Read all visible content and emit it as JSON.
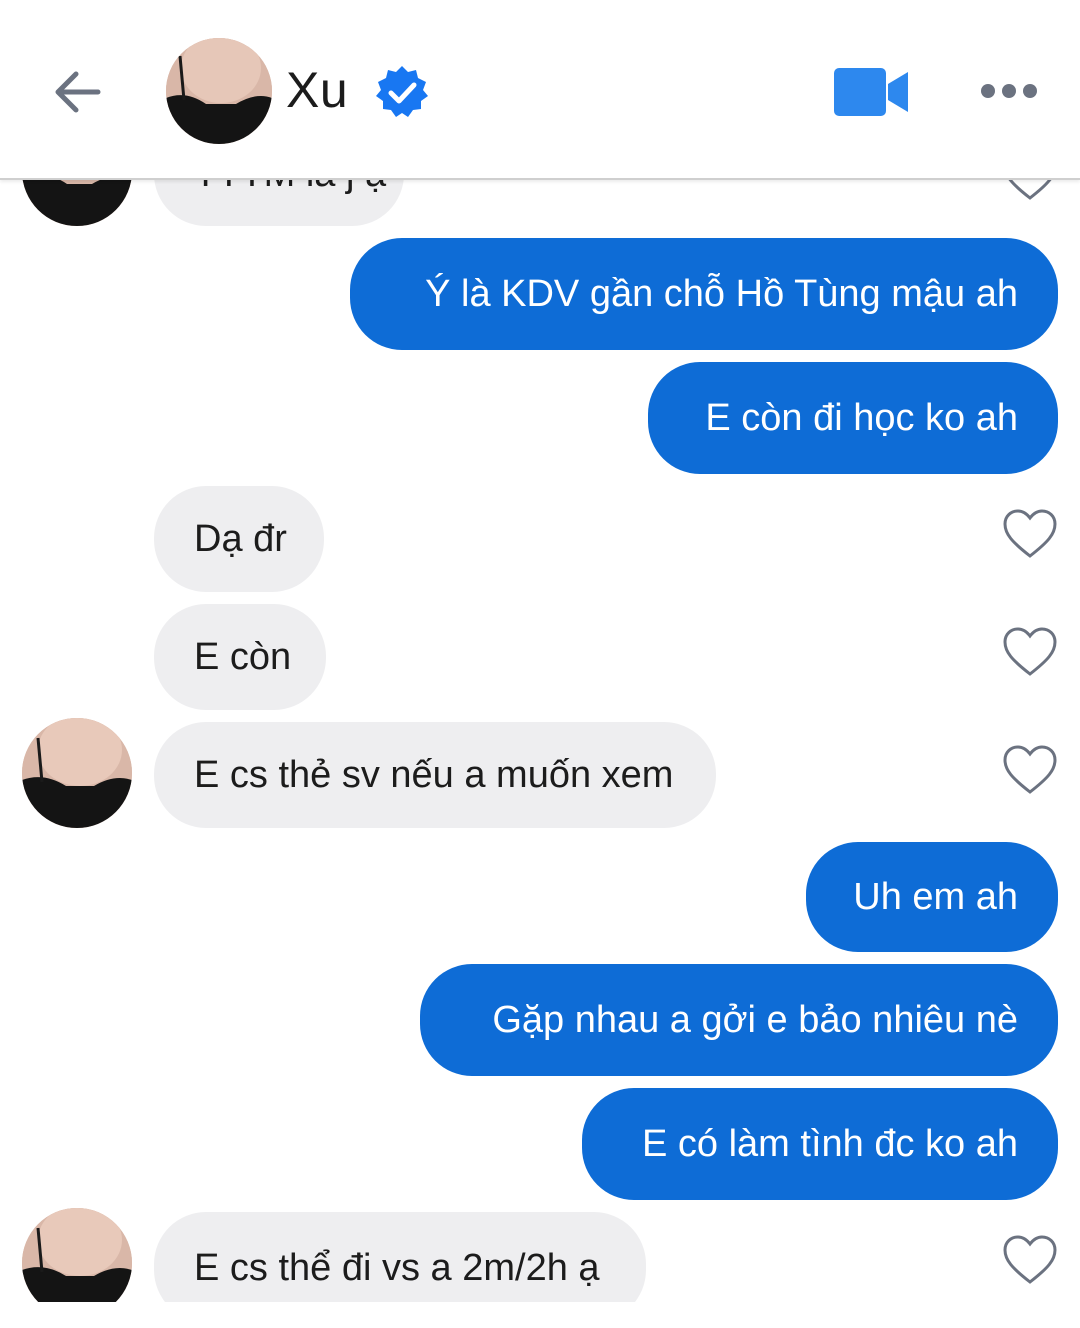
{
  "header": {
    "contact_name": "Xu",
    "verified_icon": "verified-badge-icon",
    "back_icon": "back-arrow-icon",
    "video_icon": "video-call-icon",
    "more_icon": "more-options-icon"
  },
  "colors": {
    "accent": "#0e6cd6",
    "outgoing_bubble": "#0e6cd6",
    "incoming_bubble": "#eeeef0",
    "verified": "#1877f2",
    "header_icon": "#1877f2"
  },
  "messages": [
    {
      "id": "m0",
      "direction": "incoming",
      "text": "TTTM là j ạ",
      "partial": true
    },
    {
      "id": "m1",
      "direction": "outgoing",
      "text": "Ý là KDV gần chỗ Hồ Tùng mậu ah"
    },
    {
      "id": "m2",
      "direction": "outgoing",
      "text": "E còn đi học ko ah"
    },
    {
      "id": "m3",
      "direction": "incoming",
      "text": "Dạ đr"
    },
    {
      "id": "m4",
      "direction": "incoming",
      "text": "E còn"
    },
    {
      "id": "m5",
      "direction": "incoming",
      "text": "E cs thẻ sv nếu a muốn xem"
    },
    {
      "id": "m6",
      "direction": "outgoing",
      "text": "Uh em ah"
    },
    {
      "id": "m7",
      "direction": "outgoing",
      "text": "Gặp nhau a gởi e bảo nhiêu nè"
    },
    {
      "id": "m8",
      "direction": "outgoing",
      "text": "E có làm tình đc ko ah"
    },
    {
      "id": "m9",
      "direction": "incoming",
      "text": "E cs thể đi vs a 2m/2h ạ"
    }
  ]
}
